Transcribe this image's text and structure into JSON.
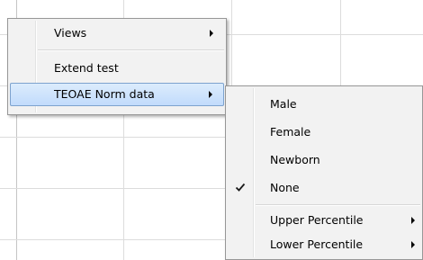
{
  "context_menu": {
    "items": [
      {
        "label": "Views",
        "has_submenu": true
      },
      {
        "label": "Extend test",
        "has_submenu": false
      },
      {
        "label": "TEOAE Norm data",
        "has_submenu": true,
        "highlighted": true
      }
    ]
  },
  "norm_submenu": {
    "items": [
      {
        "label": "Male"
      },
      {
        "label": "Female"
      },
      {
        "label": "Newborn"
      },
      {
        "label": "None",
        "checked": true
      },
      {
        "label": "Upper Percentile",
        "has_submenu": true
      },
      {
        "label": "Lower Percentile",
        "has_submenu": true
      }
    ]
  },
  "icons": {
    "check": "check-icon",
    "submenu_arrow": "chevron-right-icon"
  },
  "colors": {
    "menu_background": "#f2f2f2",
    "menu_border": "#979797",
    "highlight_border": "#7da2ce",
    "highlight_fill": "#c1dbfc",
    "grid_line": "#dcdcdc"
  }
}
